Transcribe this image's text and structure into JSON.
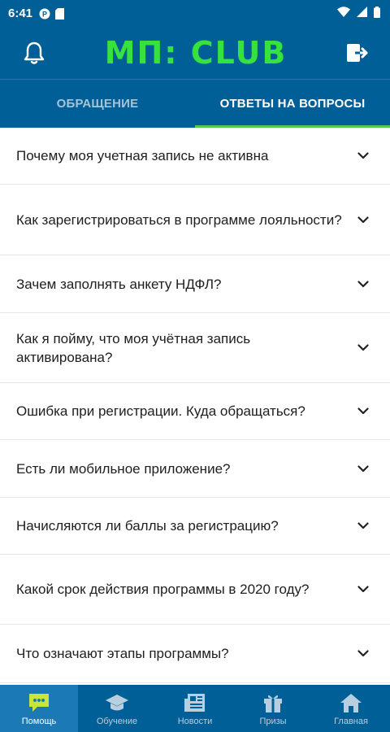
{
  "status_bar": {
    "time": "6:41"
  },
  "app_bar": {
    "logo_text": "MП: CLUB",
    "left_icon": "bell-icon",
    "right_icon": "logout-icon"
  },
  "tabs": [
    {
      "label": "ОБРАЩЕНИЕ",
      "active": false
    },
    {
      "label": "ОТВЕТЫ НА ВОПРОСЫ",
      "active": true
    }
  ],
  "faq": [
    "Почему моя учетная запись не активна",
    "Как зарегистрироваться в программе лояльности?",
    "Зачем заполнять анкету НДФЛ?",
    "Как я пойму, что моя учётная запись активирована?",
    "Ошибка при регистрации. Куда обращаться?",
    "Есть ли мобильное приложение?",
    "Начисляются ли баллы за регистрацию?",
    "Какой срок действия программы в 2020 году?",
    "Что означают этапы программы?"
  ],
  "bottom_nav": [
    {
      "label": "Помощь",
      "icon": "chat-icon",
      "active": true
    },
    {
      "label": "Обучение",
      "icon": "graduation-cap-icon",
      "active": false
    },
    {
      "label": "Новости",
      "icon": "newspaper-icon",
      "active": false
    },
    {
      "label": "Призы",
      "icon": "gift-icon",
      "active": false
    },
    {
      "label": "Главная",
      "icon": "home-icon",
      "active": false
    }
  ],
  "colors": {
    "primary": "#005f96",
    "accent_green": "#35e23e",
    "tab_indicator": "#59c94e",
    "active_nav": "#1b7ab5",
    "chat_icon": "#c8e63a"
  }
}
